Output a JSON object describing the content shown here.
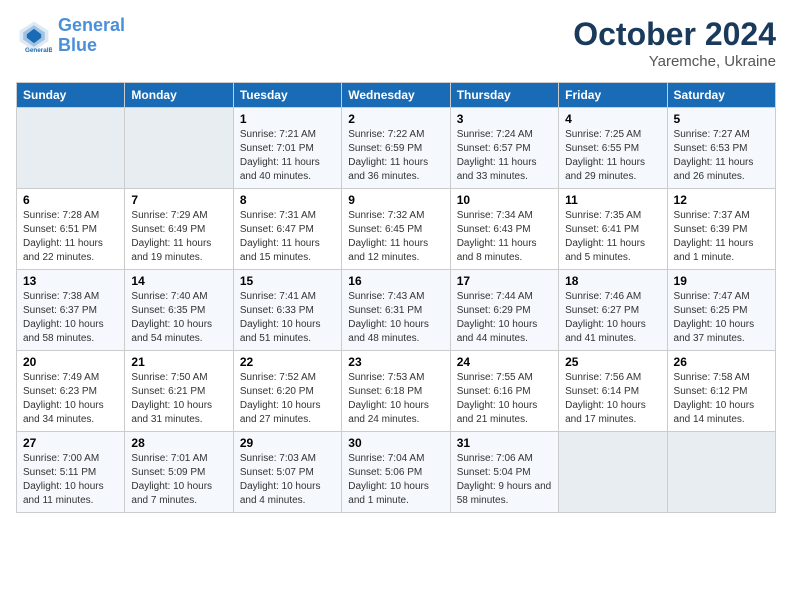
{
  "logo": {
    "line1": "General",
    "line2": "Blue"
  },
  "title": "October 2024",
  "subtitle": "Yaremche, Ukraine",
  "weekdays": [
    "Sunday",
    "Monday",
    "Tuesday",
    "Wednesday",
    "Thursday",
    "Friday",
    "Saturday"
  ],
  "weeks": [
    [
      {
        "day": "",
        "sunrise": "",
        "sunset": "",
        "daylight": ""
      },
      {
        "day": "",
        "sunrise": "",
        "sunset": "",
        "daylight": ""
      },
      {
        "day": "1",
        "sunrise": "Sunrise: 7:21 AM",
        "sunset": "Sunset: 7:01 PM",
        "daylight": "Daylight: 11 hours and 40 minutes."
      },
      {
        "day": "2",
        "sunrise": "Sunrise: 7:22 AM",
        "sunset": "Sunset: 6:59 PM",
        "daylight": "Daylight: 11 hours and 36 minutes."
      },
      {
        "day": "3",
        "sunrise": "Sunrise: 7:24 AM",
        "sunset": "Sunset: 6:57 PM",
        "daylight": "Daylight: 11 hours and 33 minutes."
      },
      {
        "day": "4",
        "sunrise": "Sunrise: 7:25 AM",
        "sunset": "Sunset: 6:55 PM",
        "daylight": "Daylight: 11 hours and 29 minutes."
      },
      {
        "day": "5",
        "sunrise": "Sunrise: 7:27 AM",
        "sunset": "Sunset: 6:53 PM",
        "daylight": "Daylight: 11 hours and 26 minutes."
      }
    ],
    [
      {
        "day": "6",
        "sunrise": "Sunrise: 7:28 AM",
        "sunset": "Sunset: 6:51 PM",
        "daylight": "Daylight: 11 hours and 22 minutes."
      },
      {
        "day": "7",
        "sunrise": "Sunrise: 7:29 AM",
        "sunset": "Sunset: 6:49 PM",
        "daylight": "Daylight: 11 hours and 19 minutes."
      },
      {
        "day": "8",
        "sunrise": "Sunrise: 7:31 AM",
        "sunset": "Sunset: 6:47 PM",
        "daylight": "Daylight: 11 hours and 15 minutes."
      },
      {
        "day": "9",
        "sunrise": "Sunrise: 7:32 AM",
        "sunset": "Sunset: 6:45 PM",
        "daylight": "Daylight: 11 hours and 12 minutes."
      },
      {
        "day": "10",
        "sunrise": "Sunrise: 7:34 AM",
        "sunset": "Sunset: 6:43 PM",
        "daylight": "Daylight: 11 hours and 8 minutes."
      },
      {
        "day": "11",
        "sunrise": "Sunrise: 7:35 AM",
        "sunset": "Sunset: 6:41 PM",
        "daylight": "Daylight: 11 hours and 5 minutes."
      },
      {
        "day": "12",
        "sunrise": "Sunrise: 7:37 AM",
        "sunset": "Sunset: 6:39 PM",
        "daylight": "Daylight: 11 hours and 1 minute."
      }
    ],
    [
      {
        "day": "13",
        "sunrise": "Sunrise: 7:38 AM",
        "sunset": "Sunset: 6:37 PM",
        "daylight": "Daylight: 10 hours and 58 minutes."
      },
      {
        "day": "14",
        "sunrise": "Sunrise: 7:40 AM",
        "sunset": "Sunset: 6:35 PM",
        "daylight": "Daylight: 10 hours and 54 minutes."
      },
      {
        "day": "15",
        "sunrise": "Sunrise: 7:41 AM",
        "sunset": "Sunset: 6:33 PM",
        "daylight": "Daylight: 10 hours and 51 minutes."
      },
      {
        "day": "16",
        "sunrise": "Sunrise: 7:43 AM",
        "sunset": "Sunset: 6:31 PM",
        "daylight": "Daylight: 10 hours and 48 minutes."
      },
      {
        "day": "17",
        "sunrise": "Sunrise: 7:44 AM",
        "sunset": "Sunset: 6:29 PM",
        "daylight": "Daylight: 10 hours and 44 minutes."
      },
      {
        "day": "18",
        "sunrise": "Sunrise: 7:46 AM",
        "sunset": "Sunset: 6:27 PM",
        "daylight": "Daylight: 10 hours and 41 minutes."
      },
      {
        "day": "19",
        "sunrise": "Sunrise: 7:47 AM",
        "sunset": "Sunset: 6:25 PM",
        "daylight": "Daylight: 10 hours and 37 minutes."
      }
    ],
    [
      {
        "day": "20",
        "sunrise": "Sunrise: 7:49 AM",
        "sunset": "Sunset: 6:23 PM",
        "daylight": "Daylight: 10 hours and 34 minutes."
      },
      {
        "day": "21",
        "sunrise": "Sunrise: 7:50 AM",
        "sunset": "Sunset: 6:21 PM",
        "daylight": "Daylight: 10 hours and 31 minutes."
      },
      {
        "day": "22",
        "sunrise": "Sunrise: 7:52 AM",
        "sunset": "Sunset: 6:20 PM",
        "daylight": "Daylight: 10 hours and 27 minutes."
      },
      {
        "day": "23",
        "sunrise": "Sunrise: 7:53 AM",
        "sunset": "Sunset: 6:18 PM",
        "daylight": "Daylight: 10 hours and 24 minutes."
      },
      {
        "day": "24",
        "sunrise": "Sunrise: 7:55 AM",
        "sunset": "Sunset: 6:16 PM",
        "daylight": "Daylight: 10 hours and 21 minutes."
      },
      {
        "day": "25",
        "sunrise": "Sunrise: 7:56 AM",
        "sunset": "Sunset: 6:14 PM",
        "daylight": "Daylight: 10 hours and 17 minutes."
      },
      {
        "day": "26",
        "sunrise": "Sunrise: 7:58 AM",
        "sunset": "Sunset: 6:12 PM",
        "daylight": "Daylight: 10 hours and 14 minutes."
      }
    ],
    [
      {
        "day": "27",
        "sunrise": "Sunrise: 7:00 AM",
        "sunset": "Sunset: 5:11 PM",
        "daylight": "Daylight: 10 hours and 11 minutes."
      },
      {
        "day": "28",
        "sunrise": "Sunrise: 7:01 AM",
        "sunset": "Sunset: 5:09 PM",
        "daylight": "Daylight: 10 hours and 7 minutes."
      },
      {
        "day": "29",
        "sunrise": "Sunrise: 7:03 AM",
        "sunset": "Sunset: 5:07 PM",
        "daylight": "Daylight: 10 hours and 4 minutes."
      },
      {
        "day": "30",
        "sunrise": "Sunrise: 7:04 AM",
        "sunset": "Sunset: 5:06 PM",
        "daylight": "Daylight: 10 hours and 1 minute."
      },
      {
        "day": "31",
        "sunrise": "Sunrise: 7:06 AM",
        "sunset": "Sunset: 5:04 PM",
        "daylight": "Daylight: 9 hours and 58 minutes."
      },
      {
        "day": "",
        "sunrise": "",
        "sunset": "",
        "daylight": ""
      },
      {
        "day": "",
        "sunrise": "",
        "sunset": "",
        "daylight": ""
      }
    ]
  ]
}
